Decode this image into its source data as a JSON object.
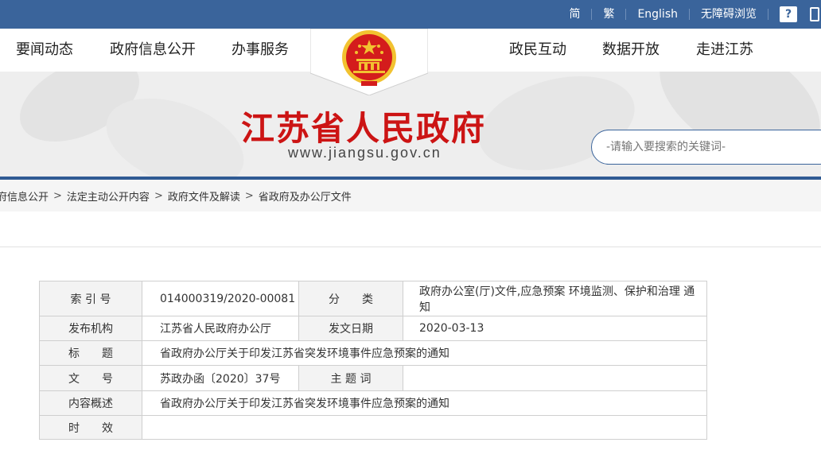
{
  "topbar": {
    "links": [
      "简",
      "繁",
      "English",
      "无障碍浏览"
    ],
    "help_icon": "help-question-icon",
    "mobile_icon": "mobile-phone-icon"
  },
  "nav": {
    "left": [
      "要闻动态",
      "政府信息公开",
      "办事服务"
    ],
    "right": [
      "政民互动",
      "数据开放",
      "走进江苏"
    ]
  },
  "site": {
    "title": "江苏省人民政府",
    "url": "www.jiangsu.gov.cn"
  },
  "search": {
    "placeholder": "-请输入要搜索的关键词-"
  },
  "breadcrumb": [
    "府信息公开",
    "法定主动公开内容",
    "政府文件及解读",
    "省政府及办公厅文件"
  ],
  "metadata": {
    "index_label": "索 引 号",
    "index_value": "014000319/2020-00081",
    "category_label": "分　　类",
    "category_value": "政府办公室(厅)文件,应急预案 环境监测、保护和治理 通知",
    "issuer_label": "发布机构",
    "issuer_value": "江苏省人民政府办公厅",
    "date_label": "发文日期",
    "date_value": "2020-03-13",
    "title_label": "标　　题",
    "title_value": "省政府办公厅关于印发江苏省突发环境事件应急预案的通知",
    "docno_label": "文　　号",
    "docno_value": "苏政办函〔2020〕37号",
    "subject_label": "主 题 词",
    "subject_value": "",
    "summary_label": "内容概述",
    "summary_value": "省政府办公厅关于印发江苏省突发环境事件应急预案的通知",
    "validity_label": "时　　效",
    "validity_value": ""
  },
  "colors": {
    "topbar": "#3a649b",
    "title_red": "#cc1414",
    "emblem_red": "#d41c1c",
    "emblem_gold": "#f2c230"
  }
}
